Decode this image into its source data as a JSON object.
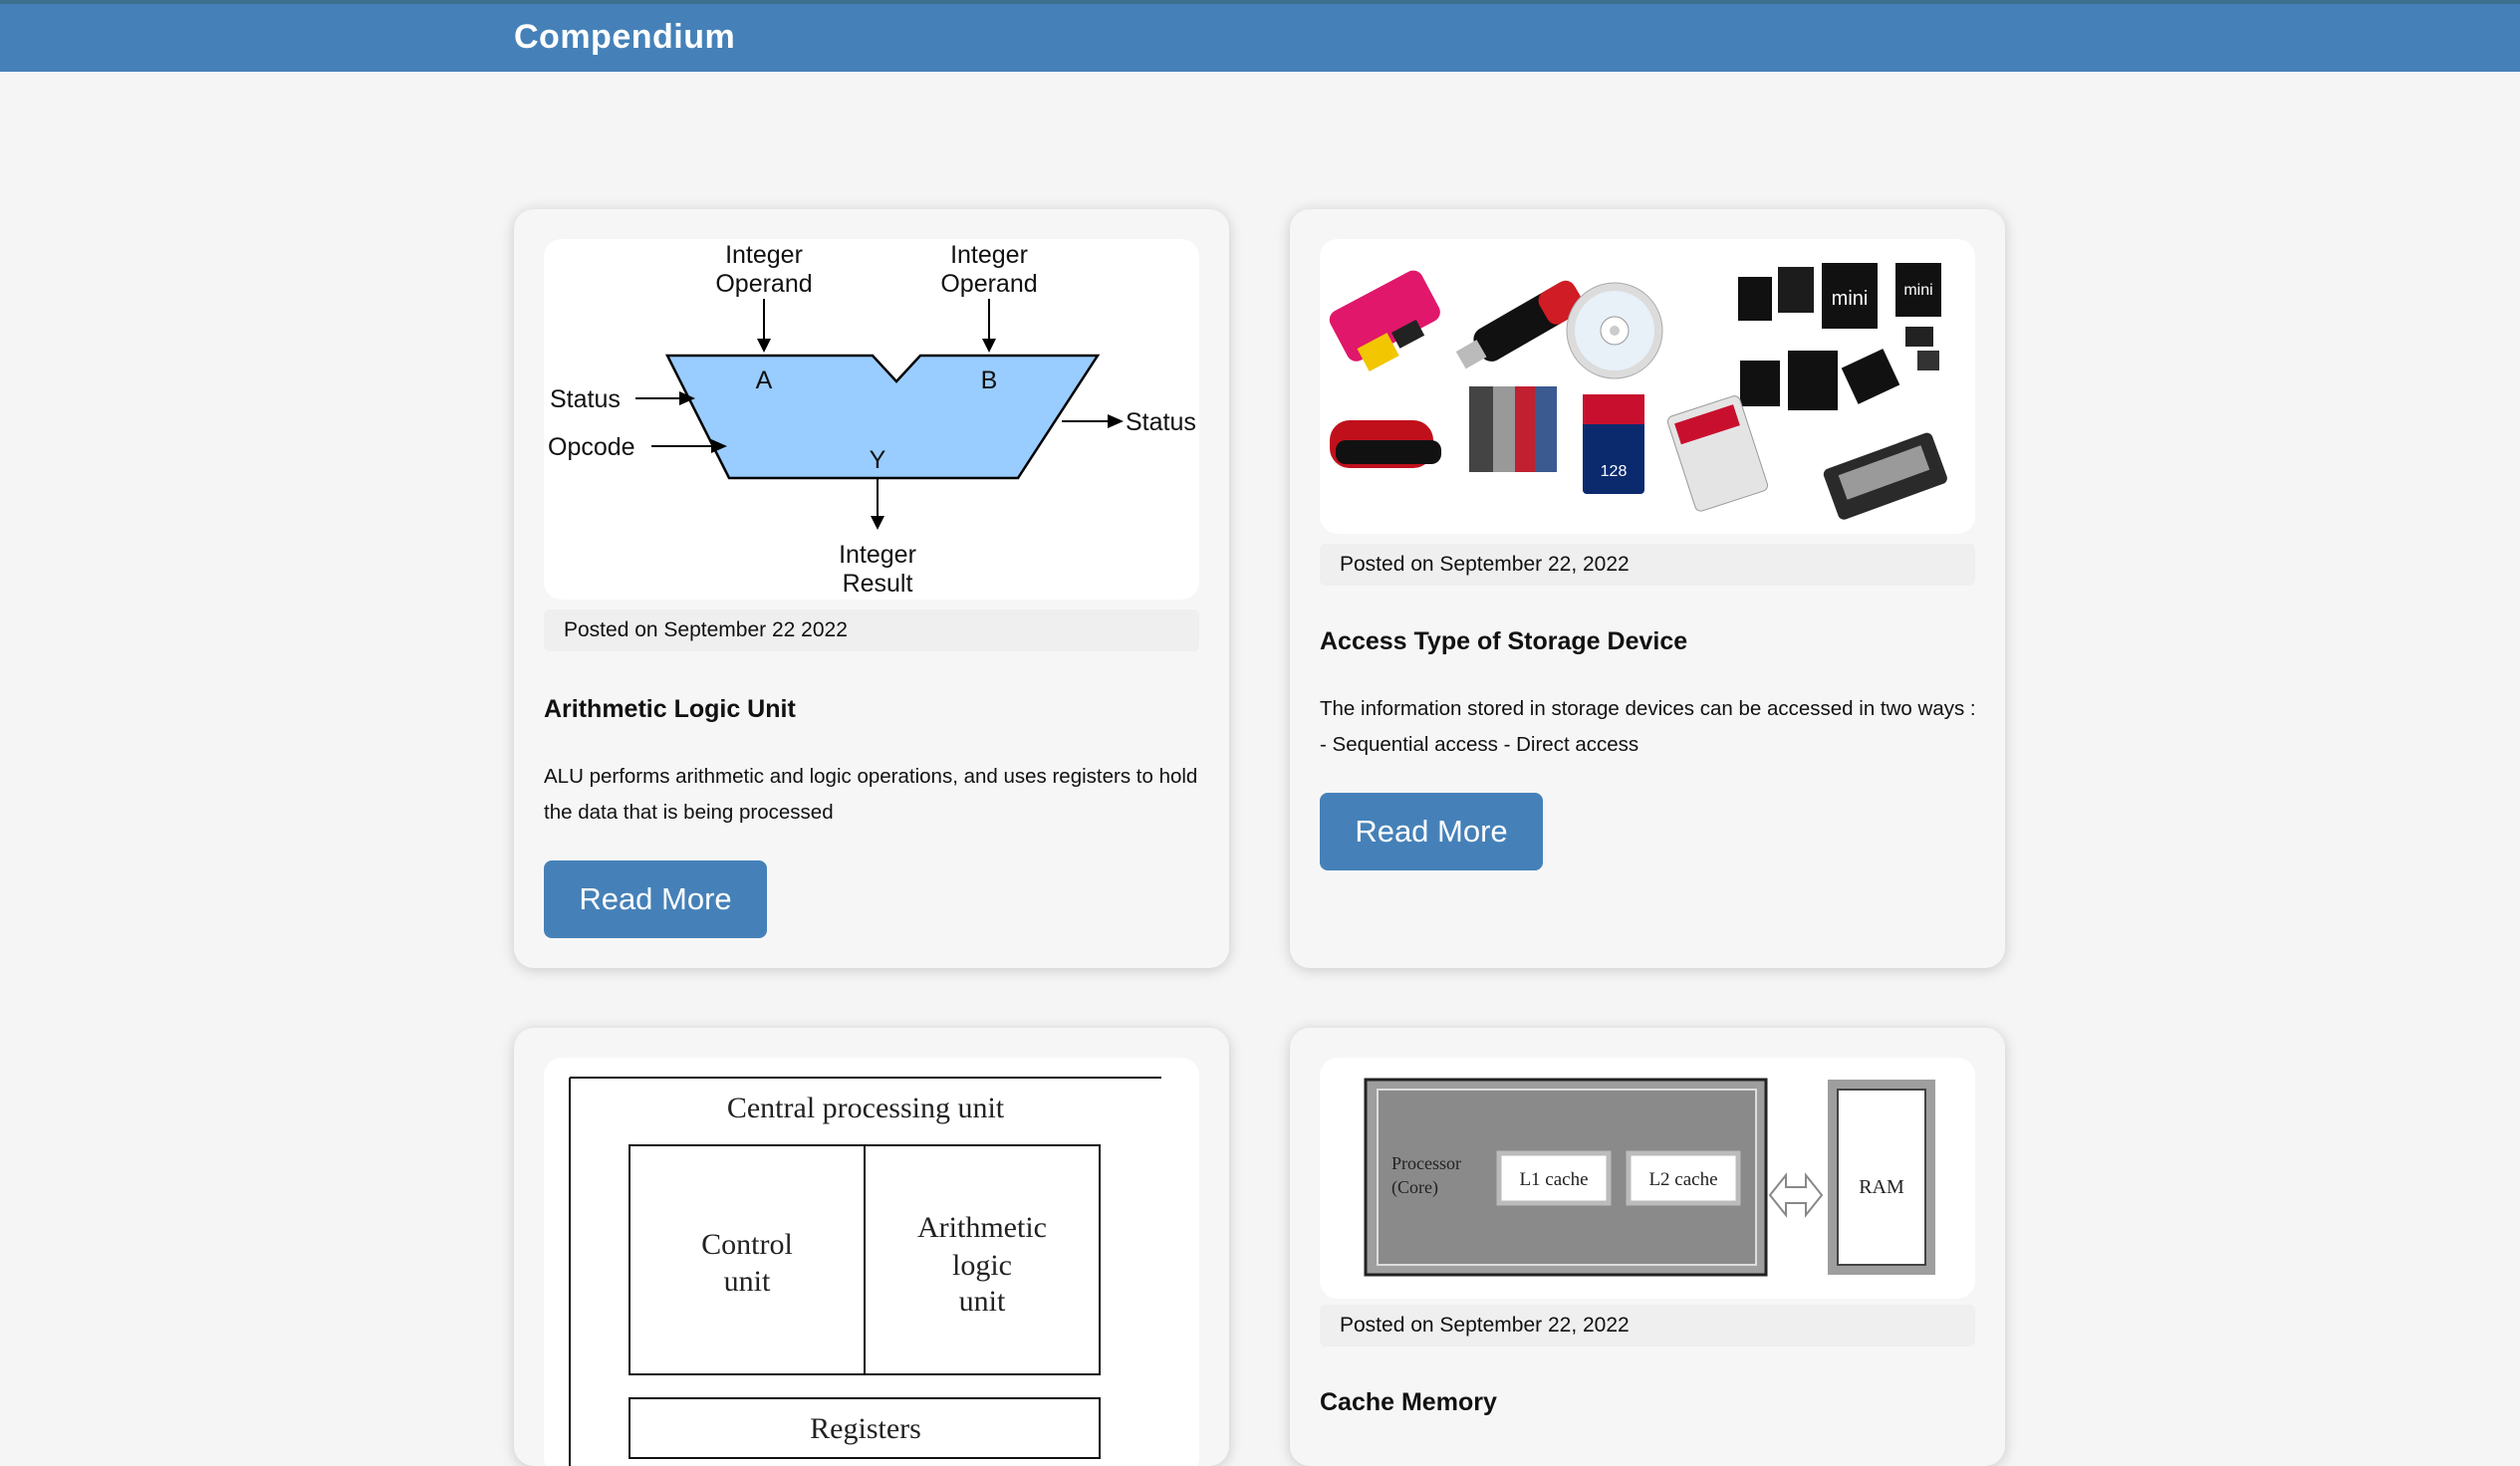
{
  "header": {
    "brand": "Compendium"
  },
  "posts": [
    {
      "posted": "Posted on September 22 2022",
      "title": "Arithmetic Logic Unit",
      "description": "ALU performs arithmetic and logic operations, and uses registers to hold the data that is being processed",
      "button": "Read More",
      "image": {
        "operand_a": [
          "Integer",
          "Operand"
        ],
        "operand_b": [
          "Integer",
          "Operand"
        ],
        "in_a": "A",
        "in_b": "B",
        "out_y": "Y",
        "status_in": "Status",
        "opcode": "Opcode",
        "status_out": "Status",
        "result": [
          "Integer",
          "Result"
        ]
      }
    },
    {
      "posted": "Posted on September 22, 2022",
      "title": "Access Type of Storage Device",
      "description": "The information stored in storage devices can be accessed in two ways : - Sequential access - Direct access",
      "button": "Read More"
    },
    {
      "image": {
        "cpu": "Central processing unit",
        "control": [
          "Control",
          "unit"
        ],
        "alu": [
          "Arithmetic",
          "logic",
          "unit"
        ],
        "registers": "Registers"
      }
    },
    {
      "posted": "Posted on September 22, 2022",
      "title": "Cache Memory",
      "image": {
        "processor": [
          "Processor",
          "(Core)"
        ],
        "l1": "L1 cache",
        "l2": "L2 cache",
        "ram": "RAM"
      }
    }
  ]
}
